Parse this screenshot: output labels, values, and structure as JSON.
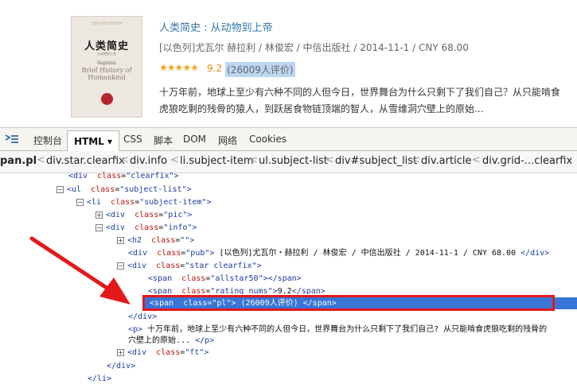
{
  "book": {
    "cover": {
      "top": "TOP FIRST EDITION",
      "cn": "人类简史",
      "sub": "从动物到上帝",
      "sapiens": "Sapiens",
      "en": "Brief History of Humankind"
    },
    "title_main": "人类简史",
    "title_sub": " : 从动物到上帝",
    "pub": "[以色列]尤瓦尔 赫拉利 / 林俊宏 / 中信出版社 / 2014-11-1 / CNY 68.00",
    "stars": "★★★★★",
    "score": "9.2",
    "pl": "(26009人评价)",
    "intro": "十万年前，地球上至少有六种不同的人但今日，世界舞台为什么只剩下了我们自己？从只能啃食虎狼吃剩的残骨的猿人，到跃居食物链顶端的智人，从雪维洞穴壁上的原始..."
  },
  "devtools": {
    "tabs": [
      "控制台",
      "HTML ▾",
      "CSS",
      "脚本",
      "DOM",
      "网络",
      "Cookies"
    ],
    "breadcrumbs": [
      "pan.pl",
      "div.star.clearfix",
      "div.info",
      "li.subject-item",
      "ul.subject-list",
      "div#subject_list",
      "div.article",
      "div.grid-...clearfix"
    ],
    "crumb_sep": "<",
    "tree": {
      "r0": {
        "open": "<div",
        "attr": "class",
        "val": "\"clearfix\"",
        "close": ">"
      },
      "r1": {
        "open": "<ul",
        "attr": "class",
        "val": "\"subject-list\"",
        "close": ">"
      },
      "r2": {
        "open": "<li",
        "attr": "class",
        "val": "\"subject-item\"",
        "close": ">"
      },
      "r3": {
        "open": "<div",
        "attr": "class",
        "val": "\"pic\"",
        "close": ">"
      },
      "r4": {
        "open": "<div",
        "attr": "class",
        "val": "\"info\"",
        "close": ">"
      },
      "r5": {
        "open": "<h2",
        "attr": "class",
        "val": "\"\"",
        "close": ">"
      },
      "r6": {
        "open": "<div",
        "attr": "class",
        "val": "\"pub\"",
        "close": ">",
        "text": " [以色列]尤瓦尔・赫拉利 / 林俊宏 / 中信出版社 / 2014-11-1 / CNY 68.00 ",
        "end": "</div>"
      },
      "r7": {
        "open": "<div",
        "attr": "class",
        "val": "\"star clearfix\"",
        "close": ">"
      },
      "r8": {
        "open": "<span",
        "attr": "class",
        "val": "\"allstar50\"",
        "close": ">",
        "end": "</span>"
      },
      "r9": {
        "open": "<span",
        "attr": "class",
        "val": "\"rating_nums\"",
        "close": ">",
        "text": "9.2",
        "end": "</span>"
      },
      "r10": {
        "open": "<span",
        "attr": "class",
        "val": "\"pl\"",
        "close": ">",
        "text": " (26009人评价) ",
        "end": "</span>"
      },
      "r11": {
        "end": "</div>"
      },
      "r12": {
        "open": "<p",
        "close": ">",
        "text": " 十万年前，地球上至少有六种不同的人但今日，世界舞台为什么只剩下了我们自己? 从只能啃食虎狼吃剩的残骨的"
      },
      "r13": {
        "text": "穴壁上的原始... ",
        "end": "</p>"
      },
      "r14": {
        "open": "<div",
        "attr": "class",
        "val": "\"ft\"",
        "close": ">"
      },
      "r15": {
        "end": "</div>"
      },
      "r16": {
        "end": "</li>"
      }
    }
  },
  "colors": {
    "selection": "#3875d7",
    "annotation": "#e3191b",
    "link": "#3377aa"
  }
}
